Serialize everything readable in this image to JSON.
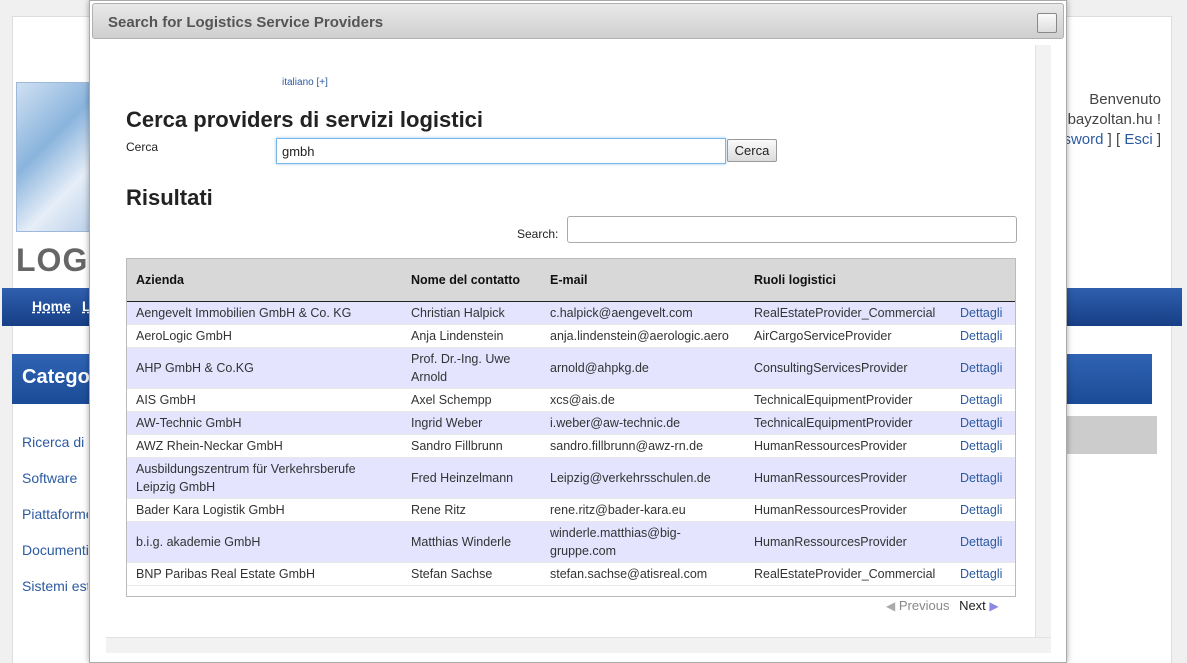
{
  "background": {
    "logo_text": "LOG",
    "nav_items": [
      "Home",
      "L"
    ],
    "category_title": "Categori",
    "side_links": [
      "Ricerca di p",
      "Software",
      "Piattaforme",
      "Documenti d",
      "Sistemi este"
    ],
    "welcome_text": "Benvenuto",
    "user_text": "@bayzoltan.hu !",
    "password_link": "ssword",
    "logout_link": "Esci"
  },
  "dialog": {
    "title": "Search for Logistics Service Providers",
    "lang_link": "italiano [+]",
    "heading": "Cerca providers di servizi logistici",
    "search_label": "Cerca",
    "search_value": "gmbh",
    "search_button": "Cerca",
    "results_heading": "Risultati",
    "filter_label": "Search:",
    "filter_value": "",
    "table": {
      "columns": [
        "Azienda",
        "Nome del contatto",
        "E-mail",
        "Ruoli logistici",
        ""
      ],
      "rows": [
        {
          "company": "Aengevelt Immobilien GmbH & Co. KG",
          "contact": "Christian Halpick",
          "email": "c.halpick@aengevelt.com",
          "role": "RealEstateProvider_Commercial",
          "details": "Dettagli"
        },
        {
          "company": "AeroLogic GmbH",
          "contact": "Anja Lindenstein",
          "email": "anja.lindenstein@aerologic.aero",
          "role": "AirCargoServiceProvider",
          "details": "Dettagli"
        },
        {
          "company": "AHP GmbH & Co.KG",
          "contact": "Prof. Dr.-Ing. Uwe Arnold",
          "email": "arnold@ahpkg.de",
          "role": "ConsultingServicesProvider",
          "details": "Dettagli"
        },
        {
          "company": "AIS GmbH",
          "contact": "Axel Schempp",
          "email": "xcs@ais.de",
          "role": "TechnicalEquipmentProvider",
          "details": "Dettagli"
        },
        {
          "company": "AW-Technic GmbH",
          "contact": "Ingrid Weber",
          "email": "i.weber@aw-technic.de",
          "role": "TechnicalEquipmentProvider",
          "details": "Dettagli"
        },
        {
          "company": "AWZ Rhein-Neckar GmbH",
          "contact": "Sandro Fillbrunn",
          "email": "sandro.fillbrunn@awz-rn.de",
          "role": "HumanRessourcesProvider",
          "details": "Dettagli"
        },
        {
          "company": "Ausbildungszentrum für Verkehrsberufe Leipzig GmbH",
          "contact": "Fred Heinzelmann",
          "email": "Leipzig@verkehrsschulen.de",
          "role": "HumanRessourcesProvider",
          "details": "Dettagli"
        },
        {
          "company": "Bader Kara Logistik GmbH",
          "contact": "Rene Ritz",
          "email": "rene.ritz@bader-kara.eu",
          "role": "HumanRessourcesProvider",
          "details": "Dettagli"
        },
        {
          "company": "b.i.g. akademie GmbH",
          "contact": "Matthias Winderle",
          "email": "winderle.matthias@big-gruppe.com",
          "role": "HumanRessourcesProvider",
          "details": "Dettagli"
        },
        {
          "company": "BNP Paribas Real Estate GmbH",
          "contact": "Stefan Sachse",
          "email": "stefan.sachse@atisreal.com",
          "role": "RealEstateProvider_Commercial",
          "details": "Dettagli"
        }
      ]
    },
    "pager": {
      "previous": "Previous",
      "next": "Next"
    }
  }
}
